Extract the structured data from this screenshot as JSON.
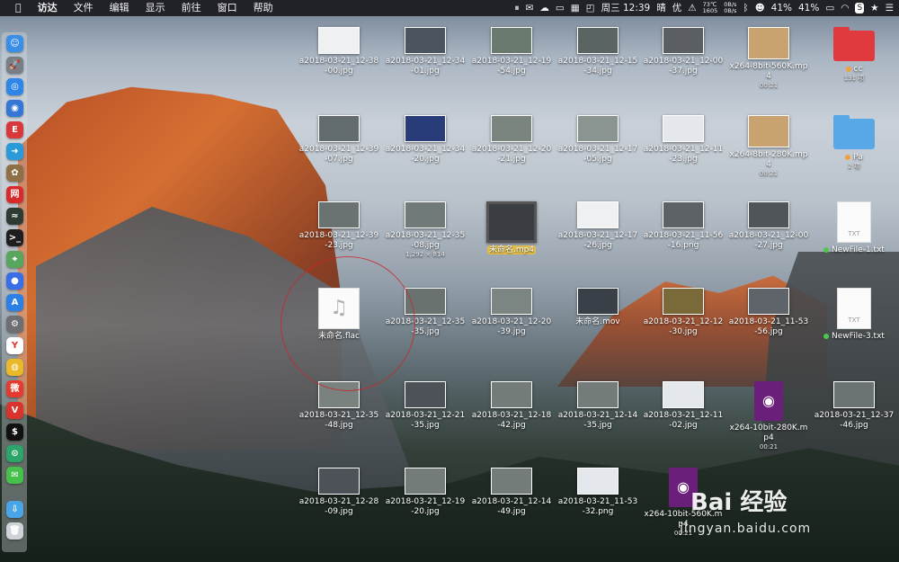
{
  "menubar": {
    "apple": "",
    "items": [
      "访达",
      "文件",
      "编辑",
      "显示",
      "前往",
      "窗口",
      "帮助"
    ],
    "status": {
      "time": "周三 12:39",
      "weather": "晴",
      "user": "优",
      "temp": "73℃",
      "fan": "1605",
      "net_up": "0B/s",
      "net_down": "0B/s",
      "battery1": "41%",
      "battery2": "41%"
    }
  },
  "dock": {
    "apps": [
      {
        "name": "finder",
        "color": "#3b8ee8",
        "glyph": "☺"
      },
      {
        "name": "launchpad",
        "color": "#777e88",
        "glyph": "🚀"
      },
      {
        "name": "safari",
        "color": "#2f86e6",
        "glyph": "◎"
      },
      {
        "name": "preview",
        "color": "#3677d6",
        "glyph": "◉"
      },
      {
        "name": "app-red",
        "color": "#d8383c",
        "glyph": "E"
      },
      {
        "name": "migration",
        "color": "#2b9ad8",
        "glyph": "➜"
      },
      {
        "name": "app-brown",
        "color": "#8e6f46",
        "glyph": "✿"
      },
      {
        "name": "netease-music",
        "color": "#d82a2a",
        "glyph": "网"
      },
      {
        "name": "activity-monitor",
        "color": "#2d3b32",
        "glyph": "≈"
      },
      {
        "name": "terminal",
        "color": "#1e1e1e",
        "glyph": ">_"
      },
      {
        "name": "maps",
        "color": "#58a55d",
        "glyph": "⌖"
      },
      {
        "name": "siri",
        "color": "#3a6ee8",
        "glyph": "●"
      },
      {
        "name": "app-store",
        "color": "#2b7fe5",
        "glyph": "A"
      },
      {
        "name": "system-preferences",
        "color": "#6d6f73",
        "glyph": "⚙"
      },
      {
        "name": "yandex",
        "color": "#ffffff",
        "glyph": "Y"
      },
      {
        "name": "chrome",
        "color": "#e9b92a",
        "glyph": "◍"
      },
      {
        "name": "weibo",
        "color": "#e53a2f",
        "glyph": "微"
      },
      {
        "name": "vivaldi",
        "color": "#d9332e",
        "glyph": "V"
      },
      {
        "name": "terminal-2",
        "color": "#111111",
        "glyph": "$"
      },
      {
        "name": "app-green",
        "color": "#2ca56a",
        "glyph": "⊙"
      },
      {
        "name": "wechat",
        "color": "#45c04a",
        "glyph": "✉"
      },
      {
        "name": "downloads-folder",
        "color": "#4aa5e8",
        "glyph": "⇩"
      },
      {
        "name": "trash",
        "color": "#cfd3d8",
        "glyph": "🗑"
      }
    ]
  },
  "files": [
    {
      "id": "f1",
      "label": "a2018-03-21_12-38-00.jpg",
      "thumb": "#eef0f2"
    },
    {
      "id": "f2",
      "label": "a2018-03-21_12-34-01.jpg",
      "thumb": "#4b5560"
    },
    {
      "id": "f3",
      "label": "a2018-03-21_12-19-54.jpg",
      "thumb": "#6b7a6e"
    },
    {
      "id": "f4",
      "label": "a2018-03-21_12-15-34.jpg",
      "thumb": "#5a6462"
    },
    {
      "id": "f5",
      "label": "a2018-03-21_12-00-37.jpg",
      "thumb": "#5b5f63"
    },
    {
      "id": "f6",
      "label": "x264-8bit-560K.mp4",
      "sub": "00:21",
      "thumb": "#c9a36f"
    },
    {
      "id": "f7",
      "label": "cc",
      "sub": "131 项",
      "folder": "#e03a3f",
      "dot": "#f0a040"
    },
    {
      "id": "f8",
      "label": "a2018-03-21_12-39-07.jpg",
      "thumb": "#626b6d"
    },
    {
      "id": "f9",
      "label": "a2018-03-21_12-34-20.jpg",
      "thumb": "#283c7a"
    },
    {
      "id": "f10",
      "label": "a2018-03-21_12-20-21.jpg",
      "thumb": "#7a8580"
    },
    {
      "id": "f11",
      "label": "a2018-03-21_12-17-05.jpg",
      "thumb": "#8a9490"
    },
    {
      "id": "f12",
      "label": "a2018-03-21_12-11-23.jpg",
      "thumb": "#e4e8ec"
    },
    {
      "id": "f13",
      "label": "x264-8bit-280K.mp4",
      "sub": "00:21",
      "thumb": "#c9a36f"
    },
    {
      "id": "f14",
      "label": "Pa",
      "sub": "2 项",
      "folder": "#58a8e8",
      "dot": "#f0a040"
    },
    {
      "id": "f15",
      "label": "a2018-03-21_12-39-23.jpg",
      "thumb": "#6a7372"
    },
    {
      "id": "f16",
      "label": "a2018-03-21_12-35-08.jpg",
      "sub": "1,292 × 814",
      "thumb": "#707a78"
    },
    {
      "id": "f17",
      "label": "未命名.mp4",
      "thumb": "#3a3e42",
      "selected": true
    },
    {
      "id": "f18",
      "label": "a2018-03-21_12-17-26.jpg",
      "thumb": "#eef0f2"
    },
    {
      "id": "f19",
      "label": "a2018-03-21_11-56-16.png",
      "thumb": "#5d6266"
    },
    {
      "id": "f20",
      "label": "a2018-03-21_12-00-27.jpg",
      "thumb": "#50555a"
    },
    {
      "id": "f21",
      "label": "NewFile-1.txt",
      "doc": "TXT",
      "dot": "#4cc94c"
    },
    {
      "id": "f22",
      "label": "未命名.flac",
      "doc": "♫"
    },
    {
      "id": "f23",
      "label": "a2018-03-21_12-35-35.jpg",
      "thumb": "#6a7270"
    },
    {
      "id": "f24",
      "label": "a2018-03-21_12-20-39.jpg",
      "thumb": "#7b8582"
    },
    {
      "id": "f25",
      "label": "未命名.mov",
      "thumb": "#3a4048"
    },
    {
      "id": "f26",
      "label": "a2018-03-21_12-12-30.jpg",
      "thumb": "#7a6a3a"
    },
    {
      "id": "f27",
      "label": "a2018-03-21_11-53-56.jpg",
      "thumb": "#5e6469"
    },
    {
      "id": "f28",
      "label": "NewFile-3.txt",
      "doc": "TXT",
      "dot": "#4cc94c"
    },
    {
      "id": "f29",
      "label": "a2018-03-21_12-35-48.jpg",
      "thumb": "#7a827f"
    },
    {
      "id": "f30",
      "label": "a2018-03-21_12-21-35.jpg",
      "thumb": "#4c5258"
    },
    {
      "id": "f31",
      "label": "a2018-03-21_12-18-42.jpg",
      "thumb": "#737c79"
    },
    {
      "id": "f32",
      "label": "a2018-03-21_12-14-35.jpg",
      "thumb": "#737c79"
    },
    {
      "id": "f33",
      "label": "a2018-03-21_12-11-02.jpg",
      "thumb": "#e4e8ec"
    },
    {
      "id": "f34",
      "label": "x264-10bit-280K.mp4",
      "sub": "00:21",
      "video": "#6a1f7a"
    },
    {
      "id": "f35",
      "label": "a2018-03-21_12-37-46.jpg",
      "thumb": "#6b7472"
    },
    {
      "id": "f36",
      "label": "a2018-03-21_12-28-09.jpg",
      "thumb": "#4c5258"
    },
    {
      "id": "f37",
      "label": "a2018-03-21_12-19-20.jpg",
      "thumb": "#737c79"
    },
    {
      "id": "f38",
      "label": "a2018-03-21_12-14-49.jpg",
      "thumb": "#737c79"
    },
    {
      "id": "f39",
      "label": "a2018-03-21_11-53-32.png",
      "thumb": "#e4e8ec"
    },
    {
      "id": "f40",
      "label": "x264-10bit-560K.mp4",
      "sub": "00:21",
      "video": "#6a1f7a"
    }
  ],
  "watermark": {
    "text": "Bai 经验",
    "url": "jingyan.baidu.com"
  }
}
